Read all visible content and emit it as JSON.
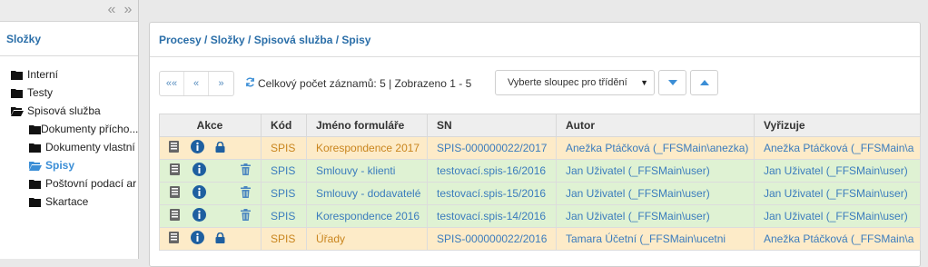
{
  "sidebar": {
    "collapse_left": "«",
    "collapse_right": "»",
    "title": "Složky",
    "items": [
      {
        "label": "Interní"
      },
      {
        "label": "Testy"
      },
      {
        "label": "Spisová služba"
      },
      {
        "label": "Dokumenty přícho..."
      },
      {
        "label": "Dokumenty vlastní"
      },
      {
        "label": "Spisy"
      },
      {
        "label": "Poštovní podací ar"
      },
      {
        "label": "Skartace"
      }
    ]
  },
  "breadcrumb": "Procesy / Složky / Spisová služba / Spisy",
  "pager": {
    "first": "««",
    "prev": "«",
    "next": "»"
  },
  "status_text": "Celkový počet záznamů: 5 | Zobrazeno 1 - 5",
  "sort": {
    "placeholder": "Vyberte sloupec pro třídění"
  },
  "table": {
    "headers": [
      "Akce",
      "Kód",
      "Jméno formuláře",
      "SN",
      "Autor",
      "Vyřizuje"
    ],
    "rows": [
      {
        "kod": "SPIS",
        "jmeno": "Korespondence 2017",
        "sn": "SPIS-000000022/2017",
        "autor": "Anežka Ptáčková (_FFSMain\\anezka)",
        "vyrizuje": "Anežka Ptáčková (_FFSMain\\a"
      },
      {
        "kod": "SPIS",
        "jmeno": "Smlouvy - klienti",
        "sn": "testovací.spis-16/2016",
        "autor": "Jan Uživatel (_FFSMain\\user)",
        "vyrizuje": "Jan Uživatel (_FFSMain\\user)"
      },
      {
        "kod": "SPIS",
        "jmeno": "Smlouvy - dodavatelé",
        "sn": "testovací.spis-15/2016",
        "autor": "Jan Uživatel (_FFSMain\\user)",
        "vyrizuje": "Jan Uživatel (_FFSMain\\user)"
      },
      {
        "kod": "SPIS",
        "jmeno": "Korespondence 2016",
        "sn": "testovací.spis-14/2016",
        "autor": "Jan Uživatel (_FFSMain\\user)",
        "vyrizuje": "Jan Uživatel (_FFSMain\\user)"
      },
      {
        "kod": "SPIS",
        "jmeno": "Úřady",
        "sn": "SPIS-000000022/2016",
        "autor": "Tamara Účetní (_FFSMain\\ucetni",
        "vyrizuje": "Anežka Ptáčková (_FFSMain\\a"
      }
    ]
  },
  "colors": {
    "accent": "#3b8ed6",
    "row_orange": "#fdebc8",
    "row_green": "#dff2d3"
  }
}
